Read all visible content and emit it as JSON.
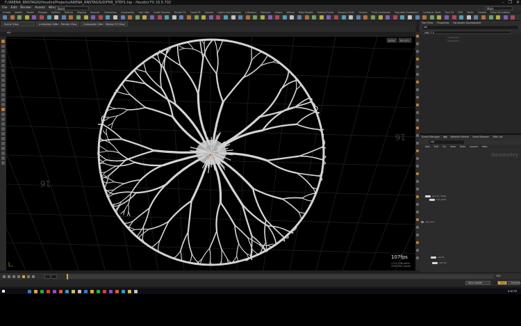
{
  "window": {
    "title": "F:/ARENA_RNSTAGIS/Houdini/Projects/ARENA_RNSTAGIS/DIFRR_STEP1.hip - Houdini FX 16.5.702",
    "controls": [
      "–",
      "❐",
      "✕"
    ]
  },
  "menubar": {
    "items": [
      "File",
      "Edit",
      "Render",
      "Assets",
      "Windows",
      "Help"
    ],
    "desktop": "Build",
    "main_selector": "Main"
  },
  "shelf": {
    "tabs": [
      "Create",
      "Modify",
      "Model",
      "Polygon",
      "Deform",
      "Texture",
      "Rigging",
      "Muscles",
      "Characters",
      "Constraints",
      "Hair Utils",
      "Guide Process",
      "Terrain FX",
      "Cloud FX",
      "Volume",
      "Lights and Cameras",
      "Collisions",
      "Particles",
      "Grains",
      "Vellum",
      "Rigid Bodies",
      "Particle Fluids",
      "Viscous Fluids",
      "Oceans",
      "Fluid Containers",
      "Populate Containers",
      "Container Tools",
      "Pyro FX",
      "FEM",
      "Wires",
      "Crowds",
      "Drive Simulation"
    ]
  },
  "tabs": [
    "Scene View",
    "Animation Editor",
    "Render View",
    "Composite View",
    "Motion FX View"
  ],
  "viewport": {
    "object_path": "obj",
    "camera_label": "persp",
    "display_label": "No cam",
    "grid_number": "16",
    "fps": "107fps",
    "stats_line1": "1,511,146  prims",
    "stats_line2": "3,091,807  points"
  },
  "parameters": {
    "tabs": [
      "Tree View",
      "Properties",
      "Parameter Spreadsheet"
    ],
    "path": "obj",
    "search_value": "/obj/ 1 0",
    "faded_lines": [
      "Operators",
      "Geometry"
    ]
  },
  "network": {
    "tabs": [
      "Scene Manager",
      "obj",
      "Material Palette",
      "Asset Browser",
      "Take List"
    ],
    "path": "obj",
    "menu": [
      "Add",
      "Edit",
      "Go",
      "View",
      "Tools",
      "Layout",
      "Help"
    ],
    "context_label": "Geometry",
    "node_names": [
      "spinner_rotate",
      "tree_splits",
      "poly_wire",
      "out_01",
      "extrude"
    ]
  },
  "timeline": {
    "frame": "1",
    "end_frame": "240"
  },
  "statusbar": {
    "buttons": [
      "Auto Update",
      "Keys",
      "Channels"
    ],
    "auto_label": "Auto Update"
  },
  "taskbar": {
    "clock": "6:40 PM"
  },
  "colors": {
    "accent": "#e0a030",
    "viewport_bg": "#000000",
    "panel_bg": "#262626"
  }
}
